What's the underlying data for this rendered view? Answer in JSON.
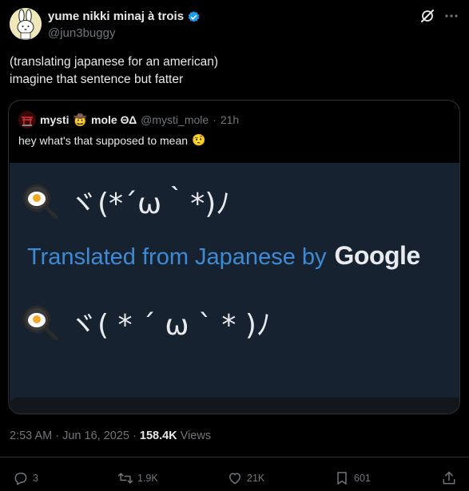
{
  "author": {
    "display_name": "yume nikki minaj à trois",
    "handle": "@jun3buggy",
    "verified": true
  },
  "tweet": {
    "line1": "(translating japanese for an american)",
    "line2": "imagine that sentence but fatter"
  },
  "quote": {
    "name": "mysti",
    "name_emoji": "🤠",
    "name_rest": "mole ΘΔ",
    "handle": "@mysti_mole",
    "separator": "·",
    "time": "21h",
    "text": "hey what's that supposed to mean",
    "text_emoji": "🤨",
    "media": {
      "kaomoji_top": "ヾ(*´ω｀*)ﾉ",
      "translated_label": "Translated from Japanese by",
      "google": "Google",
      "kaomoji_bottom": "ヾ( * ´ ω ` * )ﾉ"
    }
  },
  "meta": {
    "time": "2:53 AM",
    "date": "Jun 16, 2025",
    "separator": "·",
    "views_count": "158.4K",
    "views_label": "Views"
  },
  "actions": {
    "replies": "3",
    "reposts": "1.9K",
    "likes": "21K",
    "bookmarks": "601"
  },
  "colors": {
    "background": "#000000",
    "text": "#e7e9ea",
    "muted": "#71767b",
    "verified": "#1d9bf0",
    "translated_blue": "#3d8bd6",
    "media_bg": "#162230"
  }
}
